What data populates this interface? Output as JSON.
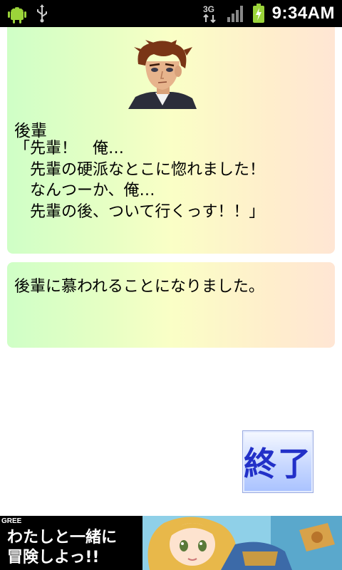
{
  "status_bar": {
    "time": "9:34AM",
    "network": "3G",
    "icons": [
      "android-icon",
      "usb-icon",
      "3g-data-icon",
      "signal-bars-icon",
      "battery-charging-icon"
    ]
  },
  "dialogue": {
    "speaker": "後輩",
    "lines": [
      "「先輩！　俺…",
      "　先輩の硬派なとこに惚れました！",
      "　なんつーか、俺…",
      "　先輩の後、ついて行くっす！！」"
    ]
  },
  "result": {
    "text": "後輩に慕われることになりました。"
  },
  "end_button": {
    "label": "終了",
    "color": "#2230c8"
  },
  "ad": {
    "brand": "GREE",
    "line1": "わたしと一緒に",
    "line2": "冒険しよっ!!"
  },
  "colors": {
    "card_gradient_left": "#cfffc6",
    "card_gradient_right": "#ffe6d4",
    "status_bar": "#000000"
  }
}
